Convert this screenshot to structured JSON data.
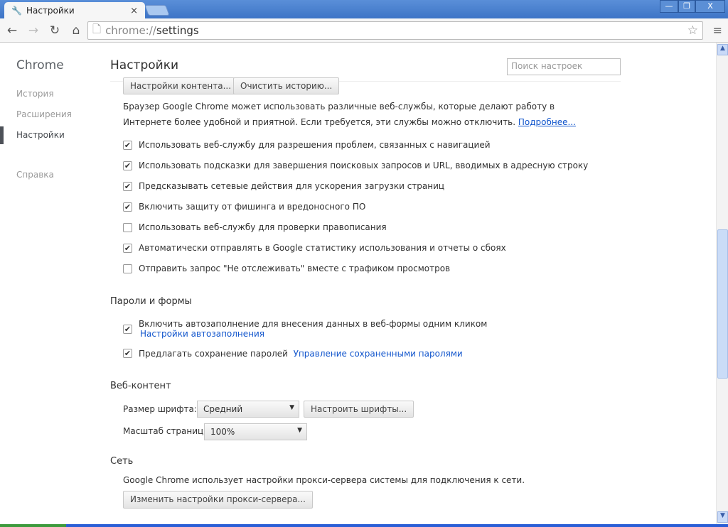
{
  "tab": {
    "title": "Настройки",
    "close": "×"
  },
  "window": {
    "min": "—",
    "restore": "❐",
    "close": "X"
  },
  "toolbar": {
    "url_scheme": "chrome://",
    "url_path": "settings"
  },
  "sidebar": {
    "brand": "Chrome",
    "items": [
      {
        "label": "История"
      },
      {
        "label": "Расширения"
      },
      {
        "label": "Настройки"
      },
      {
        "label": "Справка"
      }
    ]
  },
  "main": {
    "title": "Настройки",
    "search_placeholder": "Поиск настроек",
    "content_settings": "Настройки контента...",
    "clear_history": "Очистить историю...",
    "privacy_text1": "Браузер Google Chrome может использовать различные веб-службы, которые делают работу в",
    "privacy_text2": "Интернете более удобной и приятной. Если требуется, эти службы можно отключить.",
    "more_link": "Подробнее...",
    "privacy": [
      {
        "label": "Использовать веб-службу для разрешения проблем, связанных с навигацией",
        "checked": true
      },
      {
        "label": "Использовать подсказки для завершения поисковых запросов и URL, вводимых в адресную строку",
        "checked": true
      },
      {
        "label": "Предсказывать сетевые действия для ускорения загрузки страниц",
        "checked": true
      },
      {
        "label": "Включить защиту от фишинга и вредоносного ПО",
        "checked": true
      },
      {
        "label": "Использовать веб-службу для проверки правописания",
        "checked": false
      },
      {
        "label": "Автоматически отправлять в Google статистику использования и отчеты о сбоях",
        "checked": true
      },
      {
        "label": "Отправить запрос \"Не отслеживать\" вместе с трафиком просмотров",
        "checked": false
      }
    ],
    "passwords": {
      "title": "Пароли и формы",
      "autofill": "Включить автозаполнение для внесения данных в веб-формы одним кликом",
      "autofill_checked": true,
      "autofill_link": "Настройки автозаполнения",
      "save_pw": "Предлагать сохранение паролей",
      "save_pw_checked": true,
      "manage_link": "Управление сохраненными паролями"
    },
    "webcontent": {
      "title": "Веб-контент",
      "font_size_label": "Размер шрифта:",
      "font_size": "Средний",
      "customize_fonts": "Настроить шрифты...",
      "zoom_label": "Масштаб страницы:",
      "zoom": "100%"
    },
    "network": {
      "title": "Сеть",
      "text": "Google Chrome использует настройки прокси-сервера системы для подключения к сети.",
      "proxy_button": "Изменить настройки прокси-сервера..."
    }
  }
}
